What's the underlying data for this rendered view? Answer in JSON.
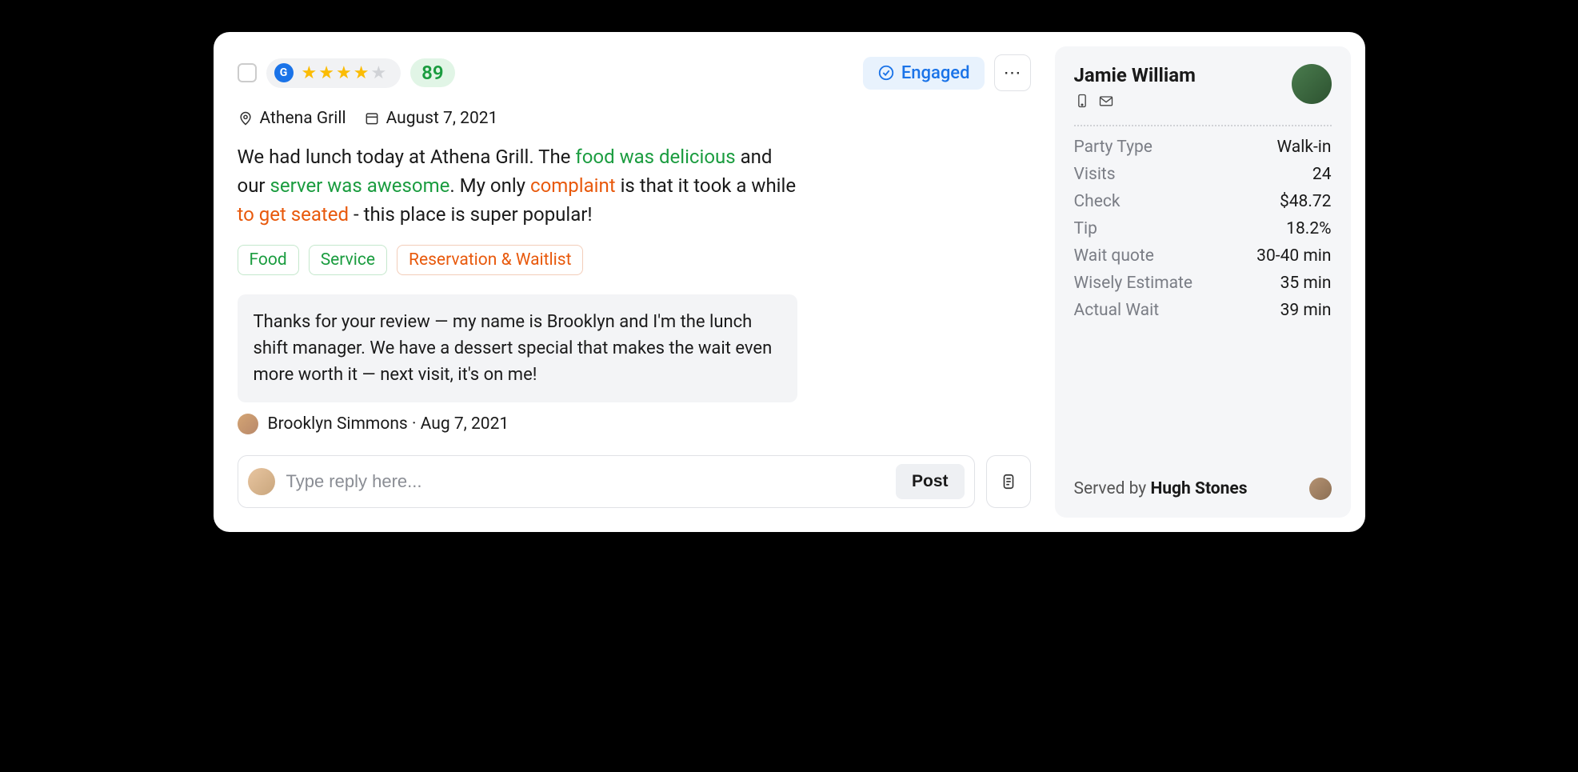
{
  "header": {
    "rating_stars": 4,
    "score": "89",
    "status": "Engaged"
  },
  "meta": {
    "location": "Athena Grill",
    "date": "August 7, 2021"
  },
  "review": {
    "seg1": "We had lunch today at Athena Grill. The ",
    "hl1": "food was delicious",
    "seg2": " and our ",
    "hl2": "server was awesome",
    "seg3": ". My only ",
    "hl3": "complaint",
    "seg4": " is that it took a while ",
    "hl4": "to get seated",
    "seg5": " - this place is super popular!"
  },
  "tags": {
    "food": "Food",
    "service": "Service",
    "reservation": "Reservation & Waitlist"
  },
  "reply": {
    "text": "Thanks for your review — my name is Brooklyn and I'm the lunch shift manager. We have a dessert special that makes the wait even more worth it — next visit, it's on me!",
    "author": "Brooklyn Simmons",
    "sep": " · ",
    "date": "Aug 7, 2021"
  },
  "compose": {
    "placeholder": "Type reply here...",
    "post_label": "Post"
  },
  "guest": {
    "name": "Jamie William",
    "info": {
      "party_type_label": "Party Type",
      "party_type_value": "Walk-in",
      "visits_label": "Visits",
      "visits_value": "24",
      "check_label": "Check",
      "check_value": "$48.72",
      "tip_label": "Tip",
      "tip_value": "18.2%",
      "wait_quote_label": "Wait quote",
      "wait_quote_value": "30-40 min",
      "wisely_est_label": "Wisely Estimate",
      "wisely_est_value": "35 min",
      "actual_wait_label": "Actual Wait",
      "actual_wait_value": "39 min"
    },
    "served_prefix": "Served by ",
    "served_name": "Hugh Stones"
  }
}
